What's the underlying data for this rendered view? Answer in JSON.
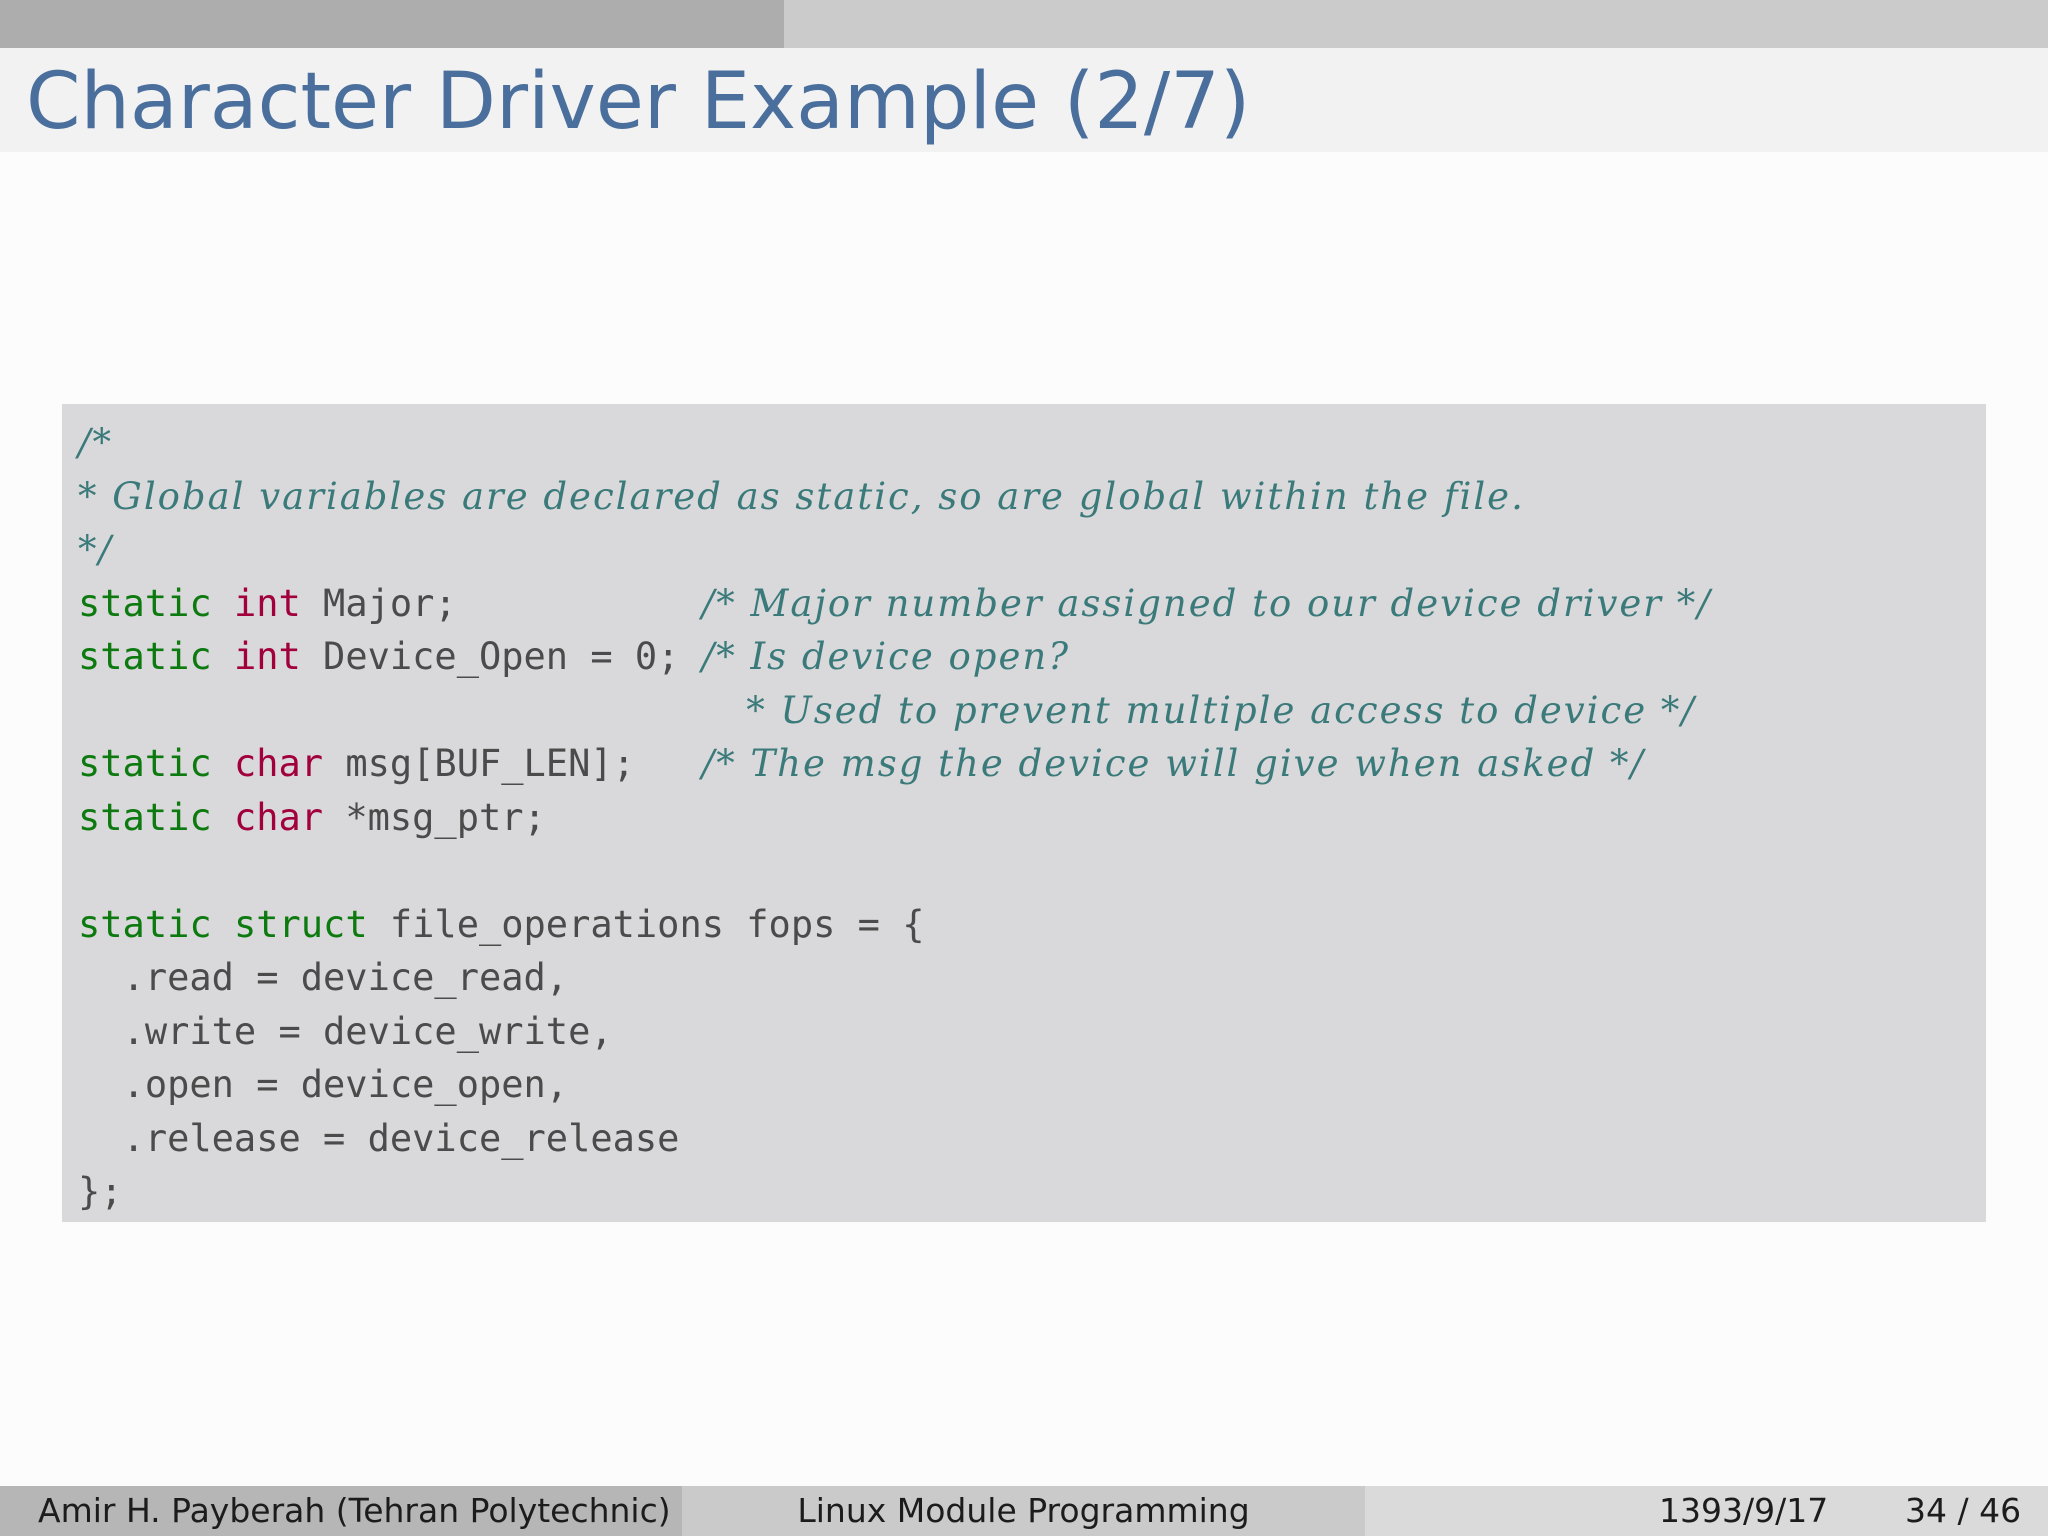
{
  "progress": {
    "fraction": 0.383
  },
  "slide": {
    "title": "Character Driver Example (2/7)"
  },
  "code": [
    [
      {
        "t": "/*",
        "c": "comment"
      }
    ],
    [
      {
        "t": "* Global variables are declared as static, so are global within the file.",
        "c": "comment"
      }
    ],
    [
      {
        "t": "*/",
        "c": "comment"
      }
    ],
    [
      {
        "t": "static",
        "c": "kw-storage"
      },
      {
        "t": " "
      },
      {
        "t": "int",
        "c": "kw-type"
      },
      {
        "t": " Major;           "
      },
      {
        "t": "/* Major number assigned to our device driver */",
        "c": "comment"
      }
    ],
    [
      {
        "t": "static",
        "c": "kw-storage"
      },
      {
        "t": " "
      },
      {
        "t": "int",
        "c": "kw-type"
      },
      {
        "t": " Device_Open = 0; "
      },
      {
        "t": "/* Is device open?",
        "c": "comment"
      }
    ],
    [
      {
        "t": "                              "
      },
      {
        "t": "* Used to prevent multiple access to device */",
        "c": "comment"
      }
    ],
    [
      {
        "t": "static",
        "c": "kw-storage"
      },
      {
        "t": " "
      },
      {
        "t": "char",
        "c": "kw-type"
      },
      {
        "t": " msg[BUF_LEN];   "
      },
      {
        "t": "/* The msg the device will give when asked */",
        "c": "comment"
      }
    ],
    [
      {
        "t": "static",
        "c": "kw-storage"
      },
      {
        "t": " "
      },
      {
        "t": "char",
        "c": "kw-type"
      },
      {
        "t": " *msg_ptr;"
      }
    ],
    [
      {
        "t": ""
      }
    ],
    [
      {
        "t": "static",
        "c": "kw-storage"
      },
      {
        "t": " "
      },
      {
        "t": "struct",
        "c": "kw-storage"
      },
      {
        "t": " file_operations fops = {"
      }
    ],
    [
      {
        "t": "  .read = device_read,"
      }
    ],
    [
      {
        "t": "  .write = device_write,"
      }
    ],
    [
      {
        "t": "  .open = device_open,"
      }
    ],
    [
      {
        "t": "  .release = device_release"
      }
    ],
    [
      {
        "t": "};"
      }
    ]
  ],
  "footer": {
    "author": "Amir H. Payberah  (Tehran Polytechnic)",
    "title": "Linux Module Programming",
    "date": "1393/9/17",
    "pages": "34 / 46"
  },
  "colors": {
    "title": "#4a6f9c",
    "keyword_storage": "#0d7a10",
    "keyword_type": "#a1003c",
    "comment": "#3a7a7a",
    "code_background": "#d9d8da"
  }
}
